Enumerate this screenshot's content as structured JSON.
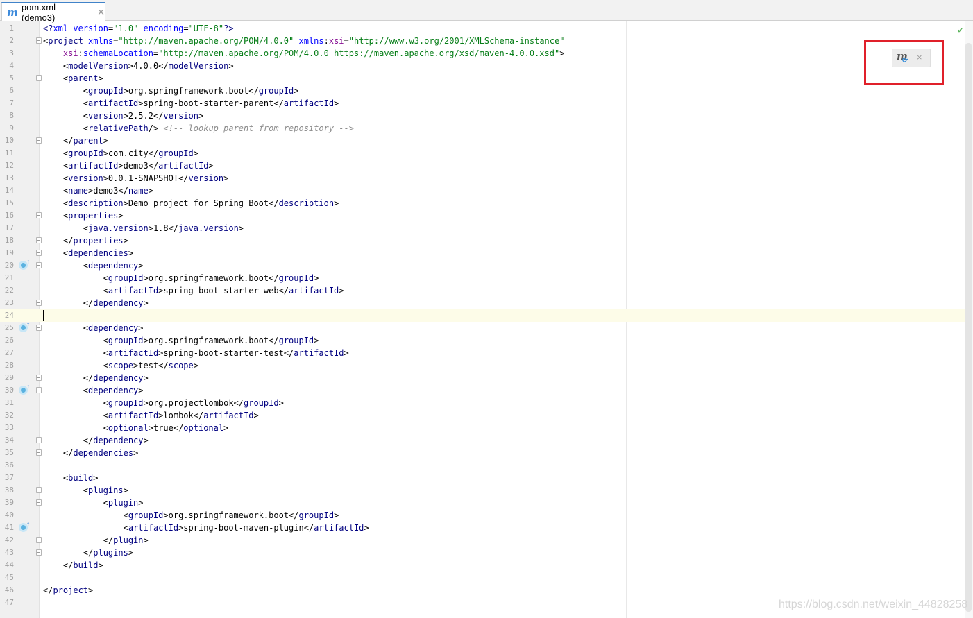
{
  "tab": {
    "icon": "m",
    "title": "pom.xml (demo3)",
    "close": "✕"
  },
  "status": {
    "inspection_icon": "✔"
  },
  "maven_popup": {
    "icon": "m",
    "reload_icon": "⟳",
    "close": "×"
  },
  "watermark": "https://blog.csdn.net/weixin_44828258",
  "line_numbers": [
    "1",
    "2",
    "3",
    "4",
    "5",
    "6",
    "7",
    "8",
    "9",
    "10",
    "11",
    "12",
    "13",
    "14",
    "15",
    "16",
    "17",
    "18",
    "19",
    "20",
    "21",
    "22",
    "23",
    "24",
    "25",
    "26",
    "27",
    "28",
    "29",
    "30",
    "31",
    "32",
    "33",
    "34",
    "35",
    "36",
    "37",
    "38",
    "39",
    "40",
    "41",
    "42",
    "43",
    "44",
    "45",
    "46",
    "47"
  ],
  "current_line": 24,
  "bean_lines": [
    20,
    25,
    30,
    41
  ],
  "fold_lines": [
    2,
    5,
    10,
    16,
    18,
    19,
    20,
    23,
    25,
    29,
    30,
    34,
    35,
    38,
    39,
    42,
    43
  ],
  "colors": {
    "tag": "#000080",
    "attribute": "#0000ff",
    "value": "#067d17",
    "comment": "#8c8c8c",
    "namespace": "#871094",
    "highlight_box": "#e0202a"
  },
  "code_lines": [
    [
      [
        "t",
        "<?"
      ],
      [
        "a",
        "xml "
      ],
      [
        "a",
        "version"
      ],
      [
        "",
        "="
      ],
      [
        "v",
        "\"1.0\""
      ],
      [
        "a",
        " encoding"
      ],
      [
        "",
        "="
      ],
      [
        "v",
        "\"UTF-8\""
      ],
      [
        "t",
        "?>"
      ]
    ],
    [
      [
        "",
        "<"
      ],
      [
        "t",
        "project "
      ],
      [
        "a",
        "xmlns"
      ],
      [
        "",
        "="
      ],
      [
        "v",
        "\"http://maven.apache.org/POM/4.0.0\""
      ],
      [
        "a",
        " xmlns"
      ],
      [
        "",
        ":"
      ],
      [
        "ns",
        "xsi"
      ],
      [
        "",
        "="
      ],
      [
        "v",
        "\"http://www.w3.org/2001/XMLSchema-instance\""
      ]
    ],
    [
      [
        "",
        "    "
      ],
      [
        "ns",
        "xsi"
      ],
      [
        "",
        ":"
      ],
      [
        "a",
        "schemaLocation"
      ],
      [
        "",
        "="
      ],
      [
        "v",
        "\"http://maven.apache.org/POM/4.0.0 https://maven.apache.org/xsd/maven-4.0.0.xsd\""
      ],
      [
        "",
        ">"
      ]
    ],
    [
      [
        "",
        "    <"
      ],
      [
        "t",
        "modelVersion"
      ],
      [
        "",
        ">4.0.0</"
      ],
      [
        "t",
        "modelVersion"
      ],
      [
        "",
        ">"
      ]
    ],
    [
      [
        "",
        "    <"
      ],
      [
        "t",
        "parent"
      ],
      [
        "",
        ">"
      ]
    ],
    [
      [
        "",
        "        <"
      ],
      [
        "t",
        "groupId"
      ],
      [
        "",
        ">org.springframework.boot</"
      ],
      [
        "t",
        "groupId"
      ],
      [
        "",
        ">"
      ]
    ],
    [
      [
        "",
        "        <"
      ],
      [
        "t",
        "artifactId"
      ],
      [
        "",
        ">spring-boot-starter-parent</"
      ],
      [
        "t",
        "artifactId"
      ],
      [
        "",
        ">"
      ]
    ],
    [
      [
        "",
        "        <"
      ],
      [
        "t",
        "version"
      ],
      [
        "",
        ">2.5.2</"
      ],
      [
        "t",
        "version"
      ],
      [
        "",
        ">"
      ]
    ],
    [
      [
        "",
        "        <"
      ],
      [
        "t",
        "relativePath"
      ],
      [
        "",
        "/> "
      ],
      [
        "c",
        "<!-- lookup parent from repository -->"
      ]
    ],
    [
      [
        "",
        "    </"
      ],
      [
        "t",
        "parent"
      ],
      [
        "",
        ">"
      ]
    ],
    [
      [
        "",
        "    <"
      ],
      [
        "t",
        "groupId"
      ],
      [
        "",
        ">com.city</"
      ],
      [
        "t",
        "groupId"
      ],
      [
        "",
        ">"
      ]
    ],
    [
      [
        "",
        "    <"
      ],
      [
        "t",
        "artifactId"
      ],
      [
        "",
        ">demo3</"
      ],
      [
        "t",
        "artifactId"
      ],
      [
        "",
        ">"
      ]
    ],
    [
      [
        "",
        "    <"
      ],
      [
        "t",
        "version"
      ],
      [
        "",
        ">0.0.1-SNAPSHOT</"
      ],
      [
        "t",
        "version"
      ],
      [
        "",
        ">"
      ]
    ],
    [
      [
        "",
        "    <"
      ],
      [
        "t",
        "name"
      ],
      [
        "",
        ">demo3</"
      ],
      [
        "t",
        "name"
      ],
      [
        "",
        ">"
      ]
    ],
    [
      [
        "",
        "    <"
      ],
      [
        "t",
        "description"
      ],
      [
        "",
        ">Demo project for Spring Boot</"
      ],
      [
        "t",
        "description"
      ],
      [
        "",
        ">"
      ]
    ],
    [
      [
        "",
        "    <"
      ],
      [
        "t",
        "properties"
      ],
      [
        "",
        ">"
      ]
    ],
    [
      [
        "",
        "        <"
      ],
      [
        "t",
        "java.version"
      ],
      [
        "",
        ">1.8</"
      ],
      [
        "t",
        "java.version"
      ],
      [
        "",
        ">"
      ]
    ],
    [
      [
        "",
        "    </"
      ],
      [
        "t",
        "properties"
      ],
      [
        "",
        ">"
      ]
    ],
    [
      [
        "",
        "    <"
      ],
      [
        "t",
        "dependencies"
      ],
      [
        "",
        ">"
      ]
    ],
    [
      [
        "",
        "        <"
      ],
      [
        "t",
        "dependency"
      ],
      [
        "",
        ">"
      ]
    ],
    [
      [
        "",
        "            <"
      ],
      [
        "t",
        "groupId"
      ],
      [
        "",
        ">org.springframework.boot</"
      ],
      [
        "t",
        "groupId"
      ],
      [
        "",
        ">"
      ]
    ],
    [
      [
        "",
        "            <"
      ],
      [
        "t",
        "artifactId"
      ],
      [
        "",
        ">spring-boot-starter-web</"
      ],
      [
        "t",
        "artifactId"
      ],
      [
        "",
        ">"
      ]
    ],
    [
      [
        "",
        "        </"
      ],
      [
        "t",
        "dependency"
      ],
      [
        "",
        ">"
      ]
    ],
    [],
    [
      [
        "",
        "        <"
      ],
      [
        "t",
        "dependency"
      ],
      [
        "",
        ">"
      ]
    ],
    [
      [
        "",
        "            <"
      ],
      [
        "t",
        "groupId"
      ],
      [
        "",
        ">org.springframework.boot</"
      ],
      [
        "t",
        "groupId"
      ],
      [
        "",
        ">"
      ]
    ],
    [
      [
        "",
        "            <"
      ],
      [
        "t",
        "artifactId"
      ],
      [
        "",
        ">spring-boot-starter-test</"
      ],
      [
        "t",
        "artifactId"
      ],
      [
        "",
        ">"
      ]
    ],
    [
      [
        "",
        "            <"
      ],
      [
        "t",
        "scope"
      ],
      [
        "",
        ">test</"
      ],
      [
        "t",
        "scope"
      ],
      [
        "",
        ">"
      ]
    ],
    [
      [
        "",
        "        </"
      ],
      [
        "t",
        "dependency"
      ],
      [
        "",
        ">"
      ]
    ],
    [
      [
        "",
        "        <"
      ],
      [
        "t",
        "dependency"
      ],
      [
        "",
        ">"
      ]
    ],
    [
      [
        "",
        "            <"
      ],
      [
        "t",
        "groupId"
      ],
      [
        "",
        ">org.projectlombok</"
      ],
      [
        "t",
        "groupId"
      ],
      [
        "",
        ">"
      ]
    ],
    [
      [
        "",
        "            <"
      ],
      [
        "t",
        "artifactId"
      ],
      [
        "",
        ">lombok</"
      ],
      [
        "t",
        "artifactId"
      ],
      [
        "",
        ">"
      ]
    ],
    [
      [
        "",
        "            <"
      ],
      [
        "t",
        "optional"
      ],
      [
        "",
        ">true</"
      ],
      [
        "t",
        "optional"
      ],
      [
        "",
        ">"
      ]
    ],
    [
      [
        "",
        "        </"
      ],
      [
        "t",
        "dependency"
      ],
      [
        "",
        ">"
      ]
    ],
    [
      [
        "",
        "    </"
      ],
      [
        "t",
        "dependencies"
      ],
      [
        "",
        ">"
      ]
    ],
    [],
    [
      [
        "",
        "    <"
      ],
      [
        "t",
        "build"
      ],
      [
        "",
        ">"
      ]
    ],
    [
      [
        "",
        "        <"
      ],
      [
        "t",
        "plugins"
      ],
      [
        "",
        ">"
      ]
    ],
    [
      [
        "",
        "            <"
      ],
      [
        "t",
        "plugin"
      ],
      [
        "",
        ">"
      ]
    ],
    [
      [
        "",
        "                <"
      ],
      [
        "t",
        "groupId"
      ],
      [
        "",
        ">org.springframework.boot</"
      ],
      [
        "t",
        "groupId"
      ],
      [
        "",
        ">"
      ]
    ],
    [
      [
        "",
        "                <"
      ],
      [
        "t",
        "artifactId"
      ],
      [
        "",
        ">spring-boot-maven-plugin</"
      ],
      [
        "t",
        "artifactId"
      ],
      [
        "",
        ">"
      ]
    ],
    [
      [
        "",
        "            </"
      ],
      [
        "t",
        "plugin"
      ],
      [
        "",
        ">"
      ]
    ],
    [
      [
        "",
        "        </"
      ],
      [
        "t",
        "plugins"
      ],
      [
        "",
        ">"
      ]
    ],
    [
      [
        "",
        "    </"
      ],
      [
        "t",
        "build"
      ],
      [
        "",
        ">"
      ]
    ],
    [],
    [
      [
        "",
        "</"
      ],
      [
        "t",
        "project"
      ],
      [
        "",
        ">"
      ]
    ],
    []
  ]
}
